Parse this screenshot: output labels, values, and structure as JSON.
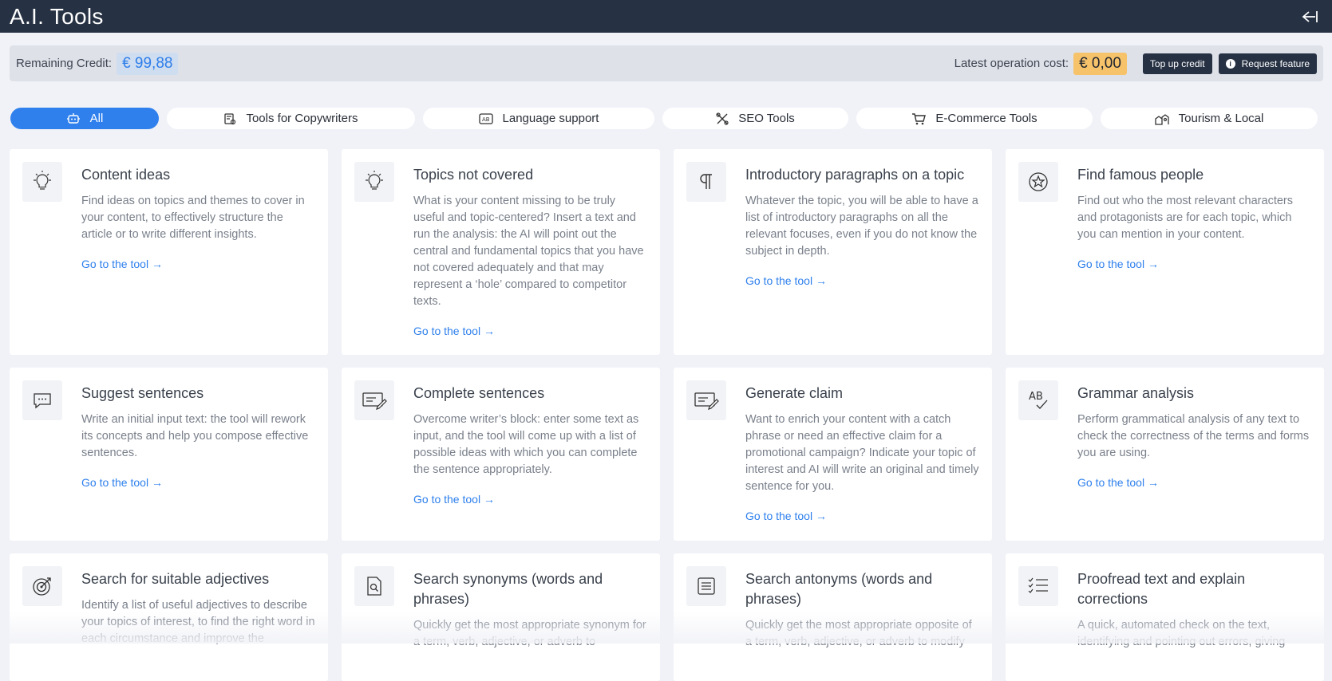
{
  "header": {
    "title": "A.I. Tools",
    "collapse_icon": "sidebar-collapse-icon"
  },
  "credit": {
    "remaining_label": "Remaining Credit:",
    "remaining_value": "€ 99,88",
    "cost_label": "Latest operation cost:",
    "cost_value": "€ 0,00",
    "topup_label": "Top up credit",
    "request_label": "Request feature"
  },
  "tabs": [
    {
      "label": "All",
      "icon": "robot-icon",
      "active": true
    },
    {
      "label": "Tools for Copywriters",
      "icon": "copywriter-icon"
    },
    {
      "label": "Language support",
      "icon": "language-icon"
    },
    {
      "label": "SEO Tools",
      "icon": "seo-tools-icon"
    },
    {
      "label": "E-Commerce Tools",
      "icon": "cart-icon"
    },
    {
      "label": "Tourism & Local",
      "icon": "tourism-icon"
    }
  ],
  "cards": [
    {
      "title": "Content ideas",
      "desc": "Find ideas on topics and themes to cover in your content, to effectively structure the article or to write different insights.",
      "link": "Go to the tool",
      "icon": "lightbulb-icon"
    },
    {
      "title": "Topics not covered",
      "desc": "What is your content missing to be truly useful and topic-centered? Insert a text and run the analysis: the AI will point out the central and fundamental topics that you have not covered adequately and that may represent a ‘hole’ compared to competitor texts.",
      "link": "Go to the tool",
      "icon": "lightbulb-icon"
    },
    {
      "title": "Introductory paragraphs on a topic",
      "desc": "Whatever the topic, you will be able to have a list of introductory paragraphs on all the relevant focuses, even if you do not know the subject in depth.",
      "link": "Go to the tool",
      "icon": "paragraph-icon"
    },
    {
      "title": "Find famous people",
      "desc": "Find out who the most relevant characters and protagonists are for each topic, which you can mention in your content.",
      "link": "Go to the tool",
      "icon": "star-badge-icon"
    },
    {
      "title": "Suggest sentences",
      "desc": "Write an initial input text: the tool will rework its concepts and help you compose effective sentences.",
      "link": "Go to the tool",
      "icon": "speech-bubble-icon"
    },
    {
      "title": "Complete sentences",
      "desc": "Overcome writer’s block: enter some text as input, and the tool will come up with a list of possible ideas with which you can complete the sentence appropriately.",
      "link": "Go to the tool",
      "icon": "edit-text-icon"
    },
    {
      "title": "Generate claim",
      "desc": "Want to enrich your content with a catch phrase or need an effective claim for a promotional campaign? Indicate your topic of interest and AI will write an original and timely sentence for you.",
      "link": "Go to the tool",
      "icon": "edit-text-icon"
    },
    {
      "title": "Grammar analysis",
      "desc": "Perform grammatical analysis of any text to check the correctness of the terms and forms you are using.",
      "link": "Go to the tool",
      "icon": "spellcheck-icon"
    },
    {
      "title": "Search for suitable adjectives",
      "desc": "Identify a list of useful adjectives to describe your topics of interest, to find the right word in each circumstance and improve the",
      "link": "",
      "icon": "target-icon"
    },
    {
      "title": "Search synonyms (words and phrases)",
      "desc": "Quickly get the most appropriate synonym for a term, verb, adjective, or adverb to",
      "link": "",
      "icon": "document-search-icon"
    },
    {
      "title": "Search antonyms (words and phrases)",
      "desc": "Quickly get the most appropriate opposite of a term, verb, adjective, or adverb to modify",
      "link": "",
      "icon": "list-icon"
    },
    {
      "title": "Proofread text and explain corrections",
      "desc": "A quick, automated check on the text, identifying and pointing out errors, giving",
      "link": "",
      "icon": "checklist-icon"
    }
  ]
}
